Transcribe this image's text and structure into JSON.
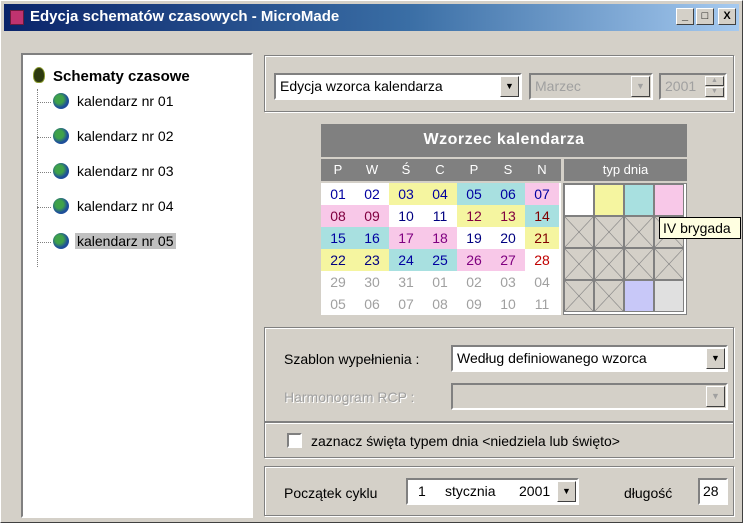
{
  "window": {
    "title": "Edycja schematów czasowych - MicroMade",
    "btn_min": "_",
    "btn_max": "□",
    "btn_close": "X"
  },
  "tree": {
    "root": "Schematy czasowe",
    "items": [
      {
        "label": "kalendarz nr 01"
      },
      {
        "label": "kalendarz nr 02"
      },
      {
        "label": "kalendarz nr 03"
      },
      {
        "label": "kalendarz nr 04"
      },
      {
        "label": "kalendarz nr 05",
        "selected": true
      }
    ]
  },
  "toolbar": {
    "mode_value": "Edycja wzorca kalendarza",
    "month_value": "Marzec",
    "year_value": "2001"
  },
  "calendar": {
    "title": "Wzorzec kalendarza",
    "day_headers": [
      "P",
      "W",
      "Ś",
      "C",
      "P",
      "S",
      "N"
    ],
    "type_header": "typ dnia",
    "rows": [
      [
        {
          "t": "01",
          "bg": "#ffffff",
          "fg": "#0000a0"
        },
        {
          "t": "02",
          "bg": "#ffffff",
          "fg": "#0000a0"
        },
        {
          "t": "03",
          "bg": "#f5f5a0",
          "fg": "#0000a0"
        },
        {
          "t": "04",
          "bg": "#f5f5a0",
          "fg": "#0000a0"
        },
        {
          "t": "05",
          "bg": "#a8e0e0",
          "fg": "#0000a0"
        },
        {
          "t": "06",
          "bg": "#a8e0e0",
          "fg": "#0000a0"
        },
        {
          "t": "07",
          "bg": "#f8c8e8",
          "fg": "#0000a0"
        }
      ],
      [
        {
          "t": "08",
          "bg": "#f8c8e8",
          "fg": "#800040"
        },
        {
          "t": "09",
          "bg": "#f8c8e8",
          "fg": "#800040"
        },
        {
          "t": "10",
          "bg": "#ffffff",
          "fg": "#000080"
        },
        {
          "t": "11",
          "bg": "#ffffff",
          "fg": "#000080"
        },
        {
          "t": "12",
          "bg": "#f5f5a0",
          "fg": "#800040"
        },
        {
          "t": "13",
          "bg": "#f5f5a0",
          "fg": "#800040"
        },
        {
          "t": "14",
          "bg": "#a8e0e0",
          "fg": "#800000"
        }
      ],
      [
        {
          "t": "15",
          "bg": "#a8e0e0",
          "fg": "#0000a0"
        },
        {
          "t": "16",
          "bg": "#a8e0e0",
          "fg": "#0000a0"
        },
        {
          "t": "17",
          "bg": "#f8c8e8",
          "fg": "#800080"
        },
        {
          "t": "18",
          "bg": "#f8c8e8",
          "fg": "#800080"
        },
        {
          "t": "19",
          "bg": "#ffffff",
          "fg": "#000080"
        },
        {
          "t": "20",
          "bg": "#ffffff",
          "fg": "#000080"
        },
        {
          "t": "21",
          "bg": "#f5f5a0",
          "fg": "#800000"
        }
      ],
      [
        {
          "t": "22",
          "bg": "#f5f5a0",
          "fg": "#000080"
        },
        {
          "t": "23",
          "bg": "#f5f5a0",
          "fg": "#000080"
        },
        {
          "t": "24",
          "bg": "#a8e0e0",
          "fg": "#0000a0"
        },
        {
          "t": "25",
          "bg": "#a8e0e0",
          "fg": "#0000a0"
        },
        {
          "t": "26",
          "bg": "#f8c8e8",
          "fg": "#800080"
        },
        {
          "t": "27",
          "bg": "#f8c8e8",
          "fg": "#800080"
        },
        {
          "t": "28",
          "bg": "#ffffff",
          "fg": "#c00000"
        }
      ],
      [
        {
          "t": "29",
          "bg": "#ffffff",
          "fg": "#a0a0a0"
        },
        {
          "t": "30",
          "bg": "#ffffff",
          "fg": "#a0a0a0"
        },
        {
          "t": "31",
          "bg": "#ffffff",
          "fg": "#a0a0a0"
        },
        {
          "t": "01",
          "bg": "#ffffff",
          "fg": "#a0a0a0"
        },
        {
          "t": "02",
          "bg": "#ffffff",
          "fg": "#a0a0a0"
        },
        {
          "t": "03",
          "bg": "#ffffff",
          "fg": "#a0a0a0"
        },
        {
          "t": "04",
          "bg": "#ffffff",
          "fg": "#a0a0a0"
        }
      ],
      [
        {
          "t": "05",
          "bg": "#ffffff",
          "fg": "#a0a0a0"
        },
        {
          "t": "06",
          "bg": "#ffffff",
          "fg": "#a0a0a0"
        },
        {
          "t": "07",
          "bg": "#ffffff",
          "fg": "#a0a0a0"
        },
        {
          "t": "08",
          "bg": "#ffffff",
          "fg": "#a0a0a0"
        },
        {
          "t": "09",
          "bg": "#ffffff",
          "fg": "#a0a0a0"
        },
        {
          "t": "10",
          "bg": "#ffffff",
          "fg": "#a0a0a0"
        },
        {
          "t": "11",
          "bg": "#ffffff",
          "fg": "#a0a0a0"
        }
      ]
    ],
    "type_cells": [
      [
        "#ffffff",
        "#f5f5a0",
        "#a8e0e0",
        "#f8c8e8"
      ],
      [
        "x",
        "x",
        "x",
        "x"
      ],
      [
        "x",
        "x",
        "x",
        "x"
      ],
      [
        "x",
        "x",
        "#c8c8f8",
        "#e0e0e0"
      ]
    ],
    "tooltip": "IV brygada"
  },
  "fill": {
    "template_label": "Szablon wypełnienia :",
    "template_value": "Według definiowanego wzorca",
    "schedule_label": "Harmonogram RCP :",
    "schedule_value": ""
  },
  "holidays": {
    "label": "zaznacz święta  typem dnia   <niedziela lub święto>",
    "checked": false
  },
  "cycle": {
    "label": "Początek cyklu",
    "day": "1",
    "month": "stycznia",
    "year": "2001",
    "length_label": "długość",
    "length_value": "28"
  }
}
